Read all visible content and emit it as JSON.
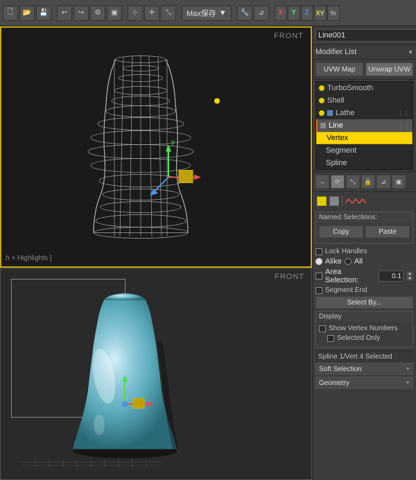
{
  "toolbar": {
    "dropdown_label": "Max保存",
    "xyz": [
      "X",
      "Y",
      "Z",
      "XY",
      "fn"
    ]
  },
  "viewport_top": {
    "label": "FRONT",
    "status": "h + Highlights ]"
  },
  "viewport_bottom": {
    "label": "FRONT"
  },
  "right_panel": {
    "obj_name": "Line001",
    "modifier_list_label": "Modifier List",
    "uvw_map_label": "UVW Map",
    "unwrap_label": "Unwrap UVW",
    "stack": [
      {
        "id": "turbosm",
        "label": "TurboSmooth",
        "indent": 0,
        "bulb": true
      },
      {
        "id": "shell",
        "label": "Shell",
        "indent": 0,
        "bulb": true
      },
      {
        "id": "lathe",
        "label": "Lathe",
        "indent": 0,
        "bulb": true,
        "box": true,
        "box_color": "blue"
      },
      {
        "id": "line",
        "label": "Line",
        "indent": 0,
        "type": "line"
      },
      {
        "id": "vertex",
        "label": "Vertex",
        "indent": 1,
        "type": "vertex"
      },
      {
        "id": "segment",
        "label": "Segment",
        "indent": 1,
        "type": "sub"
      },
      {
        "id": "spline",
        "label": "Spline",
        "indent": 1,
        "type": "sub"
      }
    ],
    "named_selections": {
      "title": "Named Selections:",
      "copy_label": "Copy",
      "paste_label": "Paste"
    },
    "lock_handles_label": "Lock Handles",
    "alike_label": "Alike",
    "all_label": "All",
    "area_selection_label": "Area Selection:",
    "area_selection_value": "0.1",
    "segment_end_label": "Segment End",
    "select_by_label": "Select By...",
    "display": {
      "title": "Display",
      "show_vertex_numbers": "Show Vertex Numbers",
      "selected_only": "Selected Only"
    },
    "status": "Spline 1/Vert 4 Selected",
    "soft_selection_label": "Soft Selection",
    "geometry_label": "Geometry"
  }
}
